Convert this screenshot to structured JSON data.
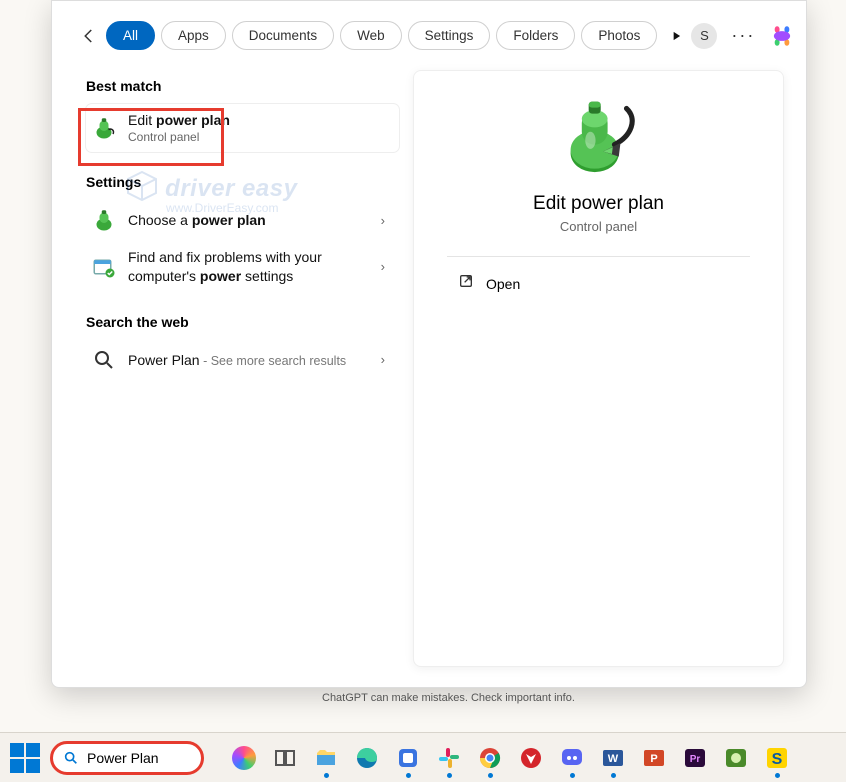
{
  "topbar": {
    "tabs": [
      "All",
      "Apps",
      "Documents",
      "Web",
      "Settings",
      "Folders",
      "Photos"
    ],
    "avatar_letter": "S"
  },
  "sections": {
    "best_match": "Best match",
    "settings": "Settings",
    "web": "Search the web"
  },
  "results": {
    "best": {
      "title_plain": "Edit ",
      "title_bold": "power plan",
      "sub": "Control panel"
    },
    "settings1": {
      "pre": "Choose a ",
      "bold": "power plan"
    },
    "settings2": {
      "line1": "Find and fix problems with your",
      "line2_pre": "computer's ",
      "line2_bold": "power",
      "line2_post": " settings"
    },
    "web1": {
      "term": "Power Plan",
      "hint": " - See more search results"
    }
  },
  "detail": {
    "title": "Edit power plan",
    "sub": "Control panel",
    "open": "Open"
  },
  "watermark": {
    "main": "driver easy",
    "sub": "www.DriverEasy.com"
  },
  "status": "ChatGPT can make mistakes. Check important info.",
  "taskbar": {
    "search_value": "Power Plan"
  }
}
